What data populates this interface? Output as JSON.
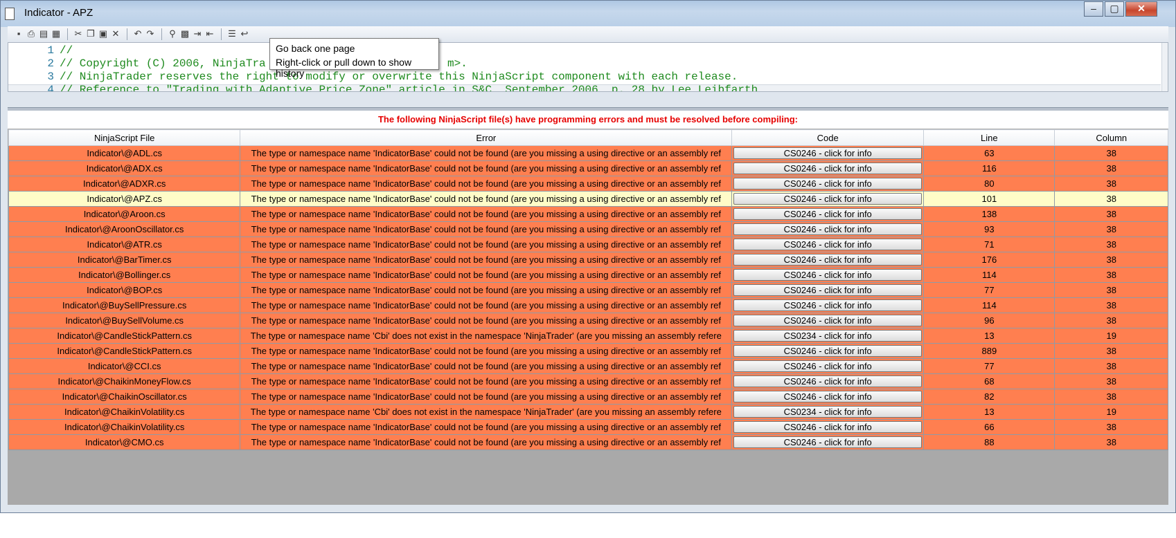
{
  "window": {
    "title": "Indicator - APZ"
  },
  "window_controls": {
    "minimize": "–",
    "maximize": "▢",
    "close": "✕"
  },
  "toolbar_icons": [
    {
      "name": "save-icon",
      "glyph": "▪"
    },
    {
      "name": "print-icon",
      "glyph": "⎙"
    },
    {
      "name": "print-preview-icon",
      "glyph": "▤"
    },
    {
      "name": "page-setup-icon",
      "glyph": "▦"
    },
    {
      "name": "cut-icon",
      "glyph": "✂"
    },
    {
      "name": "copy-icon",
      "glyph": "❐"
    },
    {
      "name": "paste-icon",
      "glyph": "▣"
    },
    {
      "name": "delete-icon",
      "glyph": "✕"
    },
    {
      "name": "undo-icon",
      "glyph": "↶"
    },
    {
      "name": "redo-icon",
      "glyph": "↷"
    },
    {
      "name": "find-icon",
      "glyph": "⚲"
    },
    {
      "name": "replace-icon",
      "glyph": "▩"
    },
    {
      "name": "indent-icon",
      "glyph": "⇥"
    },
    {
      "name": "outdent-icon",
      "glyph": "⇤"
    },
    {
      "name": "comment-icon",
      "glyph": "☰"
    },
    {
      "name": "go-back-icon",
      "glyph": "↩"
    }
  ],
  "editor": {
    "lines": [
      {
        "num": "1",
        "text": "//"
      },
      {
        "num": "2",
        "text": "// Copyright (C) 2006, NinjaTra"
      },
      {
        "num": "3",
        "text": "// NinjaTrader reserves the right to modify or overwrite this NinjaScript component with each release."
      },
      {
        "num": "4",
        "text": "// Reference to \"Trading with Adaptive Price Zone\" article in S&C, September 2006, p. 28 by Lee Leibfarth"
      }
    ],
    "line2_tail": "m>."
  },
  "tooltip": {
    "line1": "Go back one page",
    "line2": "Right-click or pull down to show history"
  },
  "errors": {
    "message": "The following NinjaScript file(s) have programming errors and must be resolved before compiling:",
    "columns": [
      "NinjaScript File",
      "Error",
      "Code",
      "Line",
      "Column"
    ],
    "rows": [
      {
        "file": "Indicator\\@ADL.cs",
        "error": "The type or namespace name 'IndicatorBase' could not be found (are you missing a using directive or an assembly ref",
        "code": "CS0246 - click for info",
        "line": "63",
        "column": "38"
      },
      {
        "file": "Indicator\\@ADX.cs",
        "error": "The type or namespace name 'IndicatorBase' could not be found (are you missing a using directive or an assembly ref",
        "code": "CS0246 - click for info",
        "line": "116",
        "column": "38"
      },
      {
        "file": "Indicator\\@ADXR.cs",
        "error": "The type or namespace name 'IndicatorBase' could not be found (are you missing a using directive or an assembly ref",
        "code": "CS0246 - click for info",
        "line": "80",
        "column": "38"
      },
      {
        "file": "Indicator\\@APZ.cs",
        "error": "The type or namespace name 'IndicatorBase' could not be found (are you missing a using directive or an assembly ref",
        "code": "CS0246 - click for info",
        "line": "101",
        "column": "38"
      },
      {
        "file": "Indicator\\@Aroon.cs",
        "error": "The type or namespace name 'IndicatorBase' could not be found (are you missing a using directive or an assembly ref",
        "code": "CS0246 - click for info",
        "line": "138",
        "column": "38"
      },
      {
        "file": "Indicator\\@AroonOscillator.cs",
        "error": "The type or namespace name 'IndicatorBase' could not be found (are you missing a using directive or an assembly ref",
        "code": "CS0246 - click for info",
        "line": "93",
        "column": "38"
      },
      {
        "file": "Indicator\\@ATR.cs",
        "error": "The type or namespace name 'IndicatorBase' could not be found (are you missing a using directive or an assembly ref",
        "code": "CS0246 - click for info",
        "line": "71",
        "column": "38"
      },
      {
        "file": "Indicator\\@BarTimer.cs",
        "error": "The type or namespace name 'IndicatorBase' could not be found (are you missing a using directive or an assembly ref",
        "code": "CS0246 - click for info",
        "line": "176",
        "column": "38"
      },
      {
        "file": "Indicator\\@Bollinger.cs",
        "error": "The type or namespace name 'IndicatorBase' could not be found (are you missing a using directive or an assembly ref",
        "code": "CS0246 - click for info",
        "line": "114",
        "column": "38"
      },
      {
        "file": "Indicator\\@BOP.cs",
        "error": "The type or namespace name 'IndicatorBase' could not be found (are you missing a using directive or an assembly ref",
        "code": "CS0246 - click for info",
        "line": "77",
        "column": "38"
      },
      {
        "file": "Indicator\\@BuySellPressure.cs",
        "error": "The type or namespace name 'IndicatorBase' could not be found (are you missing a using directive or an assembly ref",
        "code": "CS0246 - click for info",
        "line": "114",
        "column": "38"
      },
      {
        "file": "Indicator\\@BuySellVolume.cs",
        "error": "The type or namespace name 'IndicatorBase' could not be found (are you missing a using directive or an assembly ref",
        "code": "CS0246 - click for info",
        "line": "96",
        "column": "38"
      },
      {
        "file": "Indicator\\@CandleStickPattern.cs",
        "error": "The type or namespace name 'Cbi' does not exist in the namespace 'NinjaTrader' (are you missing an assembly refere",
        "code": "CS0234 - click for info",
        "line": "13",
        "column": "19"
      },
      {
        "file": "Indicator\\@CandleStickPattern.cs",
        "error": "The type or namespace name 'IndicatorBase' could not be found (are you missing a using directive or an assembly ref",
        "code": "CS0246 - click for info",
        "line": "889",
        "column": "38"
      },
      {
        "file": "Indicator\\@CCI.cs",
        "error": "The type or namespace name 'IndicatorBase' could not be found (are you missing a using directive or an assembly ref",
        "code": "CS0246 - click for info",
        "line": "77",
        "column": "38"
      },
      {
        "file": "Indicator\\@ChaikinMoneyFlow.cs",
        "error": "The type or namespace name 'IndicatorBase' could not be found (are you missing a using directive or an assembly ref",
        "code": "CS0246 - click for info",
        "line": "68",
        "column": "38"
      },
      {
        "file": "Indicator\\@ChaikinOscillator.cs",
        "error": "The type or namespace name 'IndicatorBase' could not be found (are you missing a using directive or an assembly ref",
        "code": "CS0246 - click for info",
        "line": "82",
        "column": "38"
      },
      {
        "file": "Indicator\\@ChaikinVolatility.cs",
        "error": "The type or namespace name 'Cbi' does not exist in the namespace 'NinjaTrader' (are you missing an assembly refere",
        "code": "CS0234 - click for info",
        "line": "13",
        "column": "19"
      },
      {
        "file": "Indicator\\@ChaikinVolatility.cs",
        "error": "The type or namespace name 'IndicatorBase' could not be found (are you missing a using directive or an assembly ref",
        "code": "CS0246 - click for info",
        "line": "66",
        "column": "38"
      },
      {
        "file": "Indicator\\@CMO.cs",
        "error": "The type or namespace name 'IndicatorBase' could not be found (are you missing a using directive or an assembly ref",
        "code": "CS0246 - click for info",
        "line": "88",
        "column": "38"
      }
    ]
  },
  "colors": {
    "error_row": "#ff7f50",
    "selected_row": "#fffcc8",
    "message_text": "#e60000",
    "comment_text": "#1e8a1e",
    "line_number": "#2b7a9f"
  }
}
